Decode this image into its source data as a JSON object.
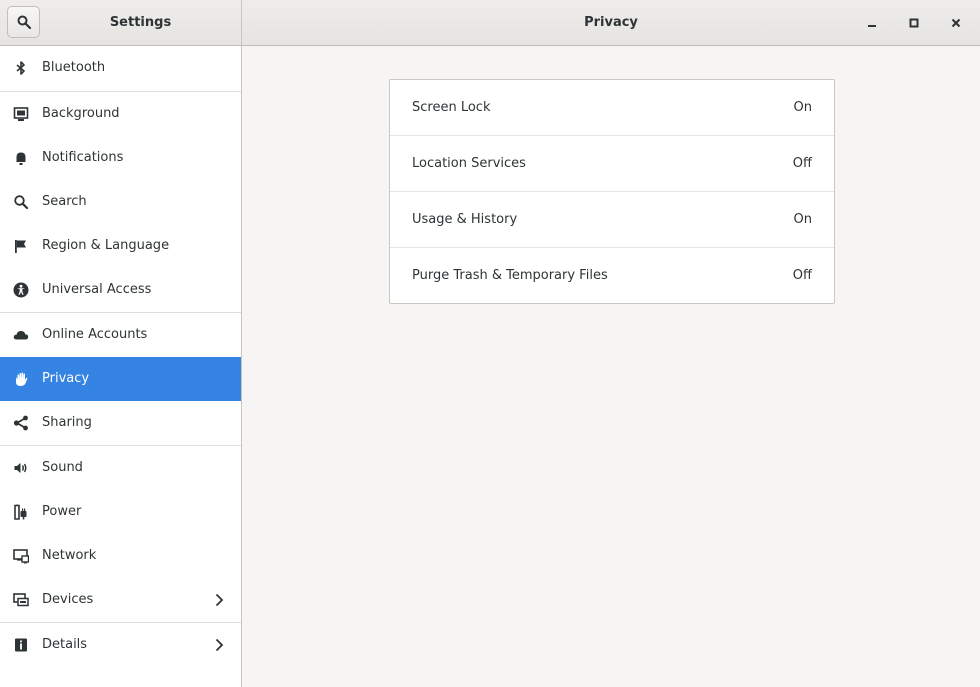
{
  "header": {
    "sidebar_title": "Settings",
    "page_title": "Privacy"
  },
  "sidebar": {
    "items": [
      {
        "label": "Bluetooth",
        "icon": "bluetooth-icon"
      },
      {
        "label": "Background",
        "icon": "background-icon"
      },
      {
        "label": "Notifications",
        "icon": "bell-icon"
      },
      {
        "label": "Search",
        "icon": "search-icon"
      },
      {
        "label": "Region & Language",
        "icon": "flag-icon"
      },
      {
        "label": "Universal Access",
        "icon": "accessibility-icon"
      },
      {
        "label": "Online Accounts",
        "icon": "cloud-icon"
      },
      {
        "label": "Privacy",
        "icon": "hand-icon",
        "selected": true
      },
      {
        "label": "Sharing",
        "icon": "share-icon"
      },
      {
        "label": "Sound",
        "icon": "speaker-icon"
      },
      {
        "label": "Power",
        "icon": "power-icon"
      },
      {
        "label": "Network",
        "icon": "network-icon"
      },
      {
        "label": "Devices",
        "icon": "devices-icon",
        "has_submenu": true
      },
      {
        "label": "Details",
        "icon": "info-icon",
        "has_submenu": true
      }
    ]
  },
  "privacy": {
    "rows": [
      {
        "label": "Screen Lock",
        "value": "On"
      },
      {
        "label": "Location Services",
        "value": "Off"
      },
      {
        "label": "Usage & History",
        "value": "On"
      },
      {
        "label": "Purge Trash & Temporary Files",
        "value": "Off"
      }
    ]
  },
  "colors": {
    "accent": "#3584e4",
    "sidebar_bg": "#ffffff",
    "content_bg": "#f6f5f4"
  }
}
